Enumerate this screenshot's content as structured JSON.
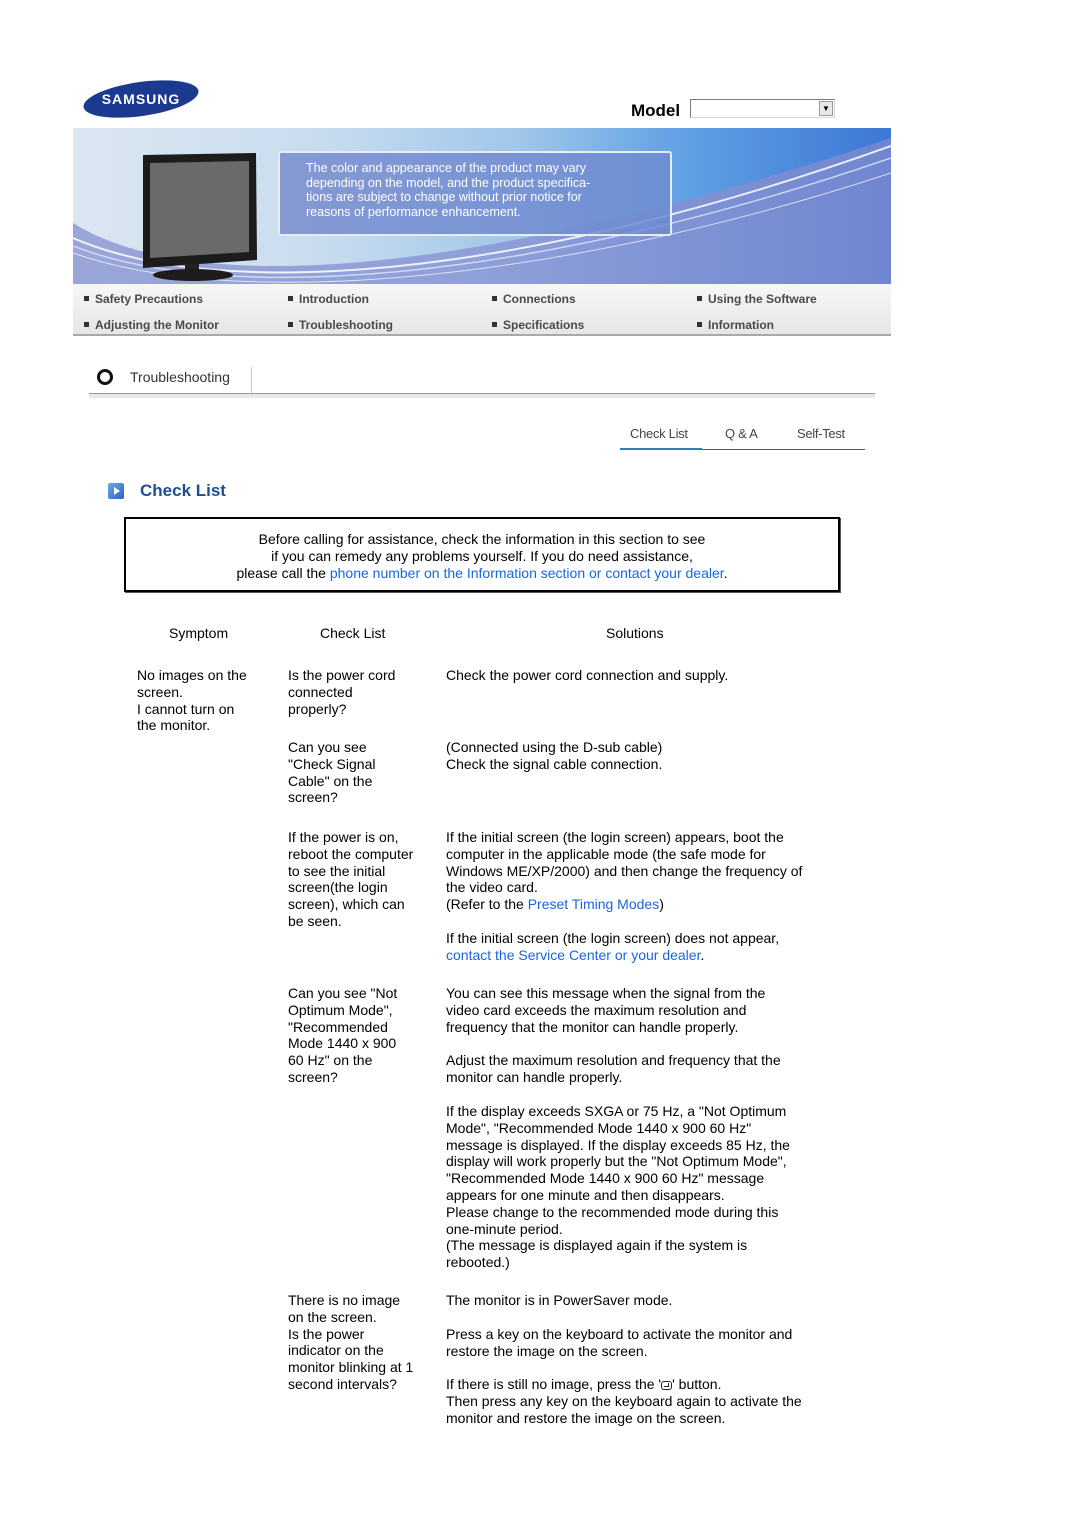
{
  "header": {
    "brand": "SAMSUNG",
    "model_label": "Model",
    "model_select_value": ""
  },
  "banner": {
    "notice_lines": [
      "The color and appearance of the product may vary",
      "depending on the model, and the product specifica-",
      "tions are subject to change without prior notice for",
      "reasons of performance enhancement."
    ]
  },
  "nav": {
    "items": [
      "Safety Precautions",
      "Introduction",
      "Connections",
      "Using the Software",
      "Adjusting the Monitor",
      "Troubleshooting",
      "Specifications",
      "Information"
    ]
  },
  "section": {
    "title": "Troubleshooting"
  },
  "tabs": [
    {
      "label": "Check List",
      "active": true
    },
    {
      "label": "Q & A",
      "active": false
    },
    {
      "label": "Self-Test",
      "active": false
    }
  ],
  "page": {
    "title": "Check List",
    "intro": {
      "line1": "Before calling for assistance, check the information in this section to see",
      "line2": "if you can remedy any problems yourself. If you do need assistance,",
      "line3_prefix": "please call the ",
      "line3_link": "phone number on the Information section or contact your dealer",
      "line3_suffix": "."
    }
  },
  "table": {
    "headers": [
      "Symptom",
      "Check List",
      "Solutions"
    ],
    "symptom": [
      "No images on the",
      "screen.",
      "I cannot turn on",
      "the monitor."
    ],
    "rows": [
      {
        "check": [
          "Is the power cord",
          "connected",
          "properly?"
        ],
        "solution": [
          "Check the power cord connection and supply."
        ]
      },
      {
        "check": [
          "Can you see",
          "\"Check Signal",
          "Cable\" on the",
          "screen?"
        ],
        "solution": [
          "(Connected using the D-sub cable)",
          "Check the signal cable connection."
        ]
      },
      {
        "check": [
          "If the power is on,",
          "reboot the computer",
          "to see the initial",
          "screen(the login",
          "screen), which can",
          "be seen."
        ],
        "solution": [
          "If the initial screen (the login screen) appears, boot the",
          "computer in the applicable mode (the safe mode for",
          "Windows ME/XP/2000) and then change the frequency of",
          "the video card."
        ],
        "refer_prefix": "(Refer to the ",
        "refer_link": "Preset Timing Modes",
        "refer_suffix": ")",
        "solution2": "If the initial screen (the login screen) does not appear,",
        "solution2_link": "contact the Service Center or your dealer",
        "solution2_suffix": "."
      },
      {
        "check": [
          "Can you see \"Not",
          "Optimum Mode\",",
          "\"Recommended",
          "Mode 1440 x 900",
          "60 Hz\" on the",
          "screen?"
        ],
        "solution_p1": [
          "You can see this message when the signal from the",
          "video card exceeds the maximum resolution and",
          "frequency that the monitor can handle properly."
        ],
        "solution_p2": [
          "Adjust the maximum resolution and frequency that the",
          "monitor can handle properly."
        ],
        "solution_p3": [
          "If the display exceeds SXGA or 75 Hz, a \"Not Optimum",
          "Mode\", \"Recommended Mode 1440 x 900 60 Hz\"",
          "message is displayed. If the display exceeds 85 Hz, the",
          "display will work properly but the \"Not Optimum Mode\",",
          "\"Recommended Mode 1440 x 900 60 Hz\" message",
          "appears for one minute and then disappears.",
          "Please change to the recommended mode during this",
          "one-minute period.",
          "(The message is displayed again if the system is",
          "rebooted.)"
        ]
      },
      {
        "check": [
          "There is no image",
          "on the screen.",
          "Is the power",
          "indicator on the",
          "monitor blinking at 1",
          "second intervals?"
        ],
        "solution_p1": "The monitor is in PowerSaver mode.",
        "solution_p2": [
          "Press a key on the keyboard to activate the monitor and",
          "restore the image on the screen."
        ],
        "solution_p3_prefix": "If there is still no image, press the '",
        "solution_p3_icon": "source-enter-icon",
        "solution_p3_suffix": "' button.",
        "solution_p3_rest": [
          "Then press any key on the keyboard again to activate the",
          "monitor and restore the image on the screen."
        ]
      }
    ]
  },
  "colors": {
    "link": "#1a66e0",
    "title": "#1d4f91",
    "tab_active_underline": "#2a82b8"
  }
}
